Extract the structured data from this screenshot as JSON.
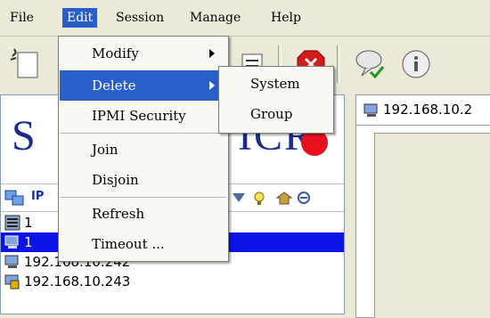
{
  "menubar": {
    "items": [
      {
        "label": "File"
      },
      {
        "label": "Edit"
      },
      {
        "label": "Session"
      },
      {
        "label": "Manage"
      },
      {
        "label": "Help"
      }
    ]
  },
  "edit_menu": {
    "items": [
      {
        "label": "Modify",
        "submenu": true
      },
      {
        "label": "Delete",
        "submenu": true
      },
      {
        "label": "IPMI Security"
      },
      {
        "label": "Join"
      },
      {
        "label": "Disjoin"
      },
      {
        "label": "Refresh"
      },
      {
        "label": "Timeout ..."
      }
    ]
  },
  "delete_submenu": {
    "items": [
      {
        "label": "System"
      },
      {
        "label": "Group"
      }
    ]
  },
  "logo": {
    "left": "S",
    "right": "ICR",
    "dot_color": "#e8101c",
    "text_color": "#1a2b8c"
  },
  "tree_header": {
    "label": "IP"
  },
  "tree": {
    "rows": [
      {
        "label": "1",
        "icon": "server-rack-icon"
      },
      {
        "label": "1",
        "icon": "computer-icon",
        "selected": true
      },
      {
        "label": "192.168.10.242",
        "icon": "computer-icon"
      },
      {
        "label": "192.168.10.243",
        "icon": "computer-ipmi-icon"
      }
    ]
  },
  "tab": {
    "label": "192.168.10.2"
  },
  "colors": {
    "highlight": "#2a5fc9",
    "selection": "#0a14e6"
  }
}
